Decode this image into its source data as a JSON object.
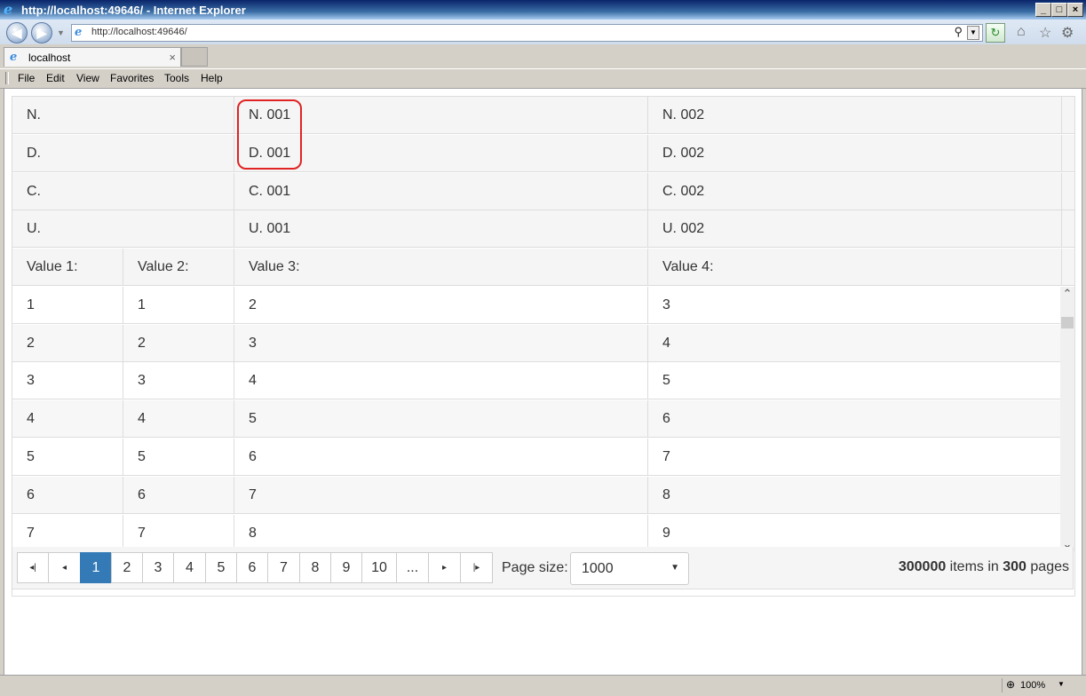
{
  "window": {
    "title": "http://localhost:49646/ - Internet Explorer",
    "min_glyph": "_",
    "max_glyph": "□",
    "close_glyph": "×"
  },
  "address": {
    "url": "http://localhost:49646/"
  },
  "tab": {
    "label": "localhost",
    "close_glyph": "×"
  },
  "menu": {
    "file": "File",
    "edit": "Edit",
    "view": "View",
    "favorites": "Favorites",
    "tools": "Tools",
    "help": "Help"
  },
  "grid": {
    "header_rows": [
      {
        "label": "N.",
        "v1": "N. 001",
        "v2": "N. 002"
      },
      {
        "label": "D.",
        "v1": "D. 001",
        "v2": "D. 002"
      },
      {
        "label": "C.",
        "v1": "C. 001",
        "v2": "C. 002"
      },
      {
        "label": "U.",
        "v1": "U. 001",
        "v2": "U. 002"
      }
    ],
    "columns": [
      "Value 1:",
      "Value 2:",
      "Value 3:",
      "Value 4:"
    ],
    "rows": [
      [
        "1",
        "1",
        "2",
        "3"
      ],
      [
        "2",
        "2",
        "3",
        "4"
      ],
      [
        "3",
        "3",
        "4",
        "5"
      ],
      [
        "4",
        "4",
        "5",
        "6"
      ],
      [
        "5",
        "5",
        "6",
        "7"
      ],
      [
        "6",
        "6",
        "7",
        "8"
      ],
      [
        "7",
        "7",
        "8",
        "9"
      ]
    ]
  },
  "pager": {
    "first": "◂|",
    "prev": "◂",
    "pages": [
      "1",
      "2",
      "3",
      "4",
      "5",
      "6",
      "7",
      "8",
      "9",
      "10",
      "..."
    ],
    "current_page": "1",
    "next": "▸",
    "last": "|▸",
    "page_size_label": "Page size:",
    "page_size_value": "1000",
    "info_items": "300000",
    "info_items_text": " items in ",
    "info_pages": "300",
    "info_pages_text": " pages"
  },
  "status": {
    "zoom": "100%"
  },
  "colors": {
    "accent": "#337ab7",
    "highlight": "#e02424"
  }
}
